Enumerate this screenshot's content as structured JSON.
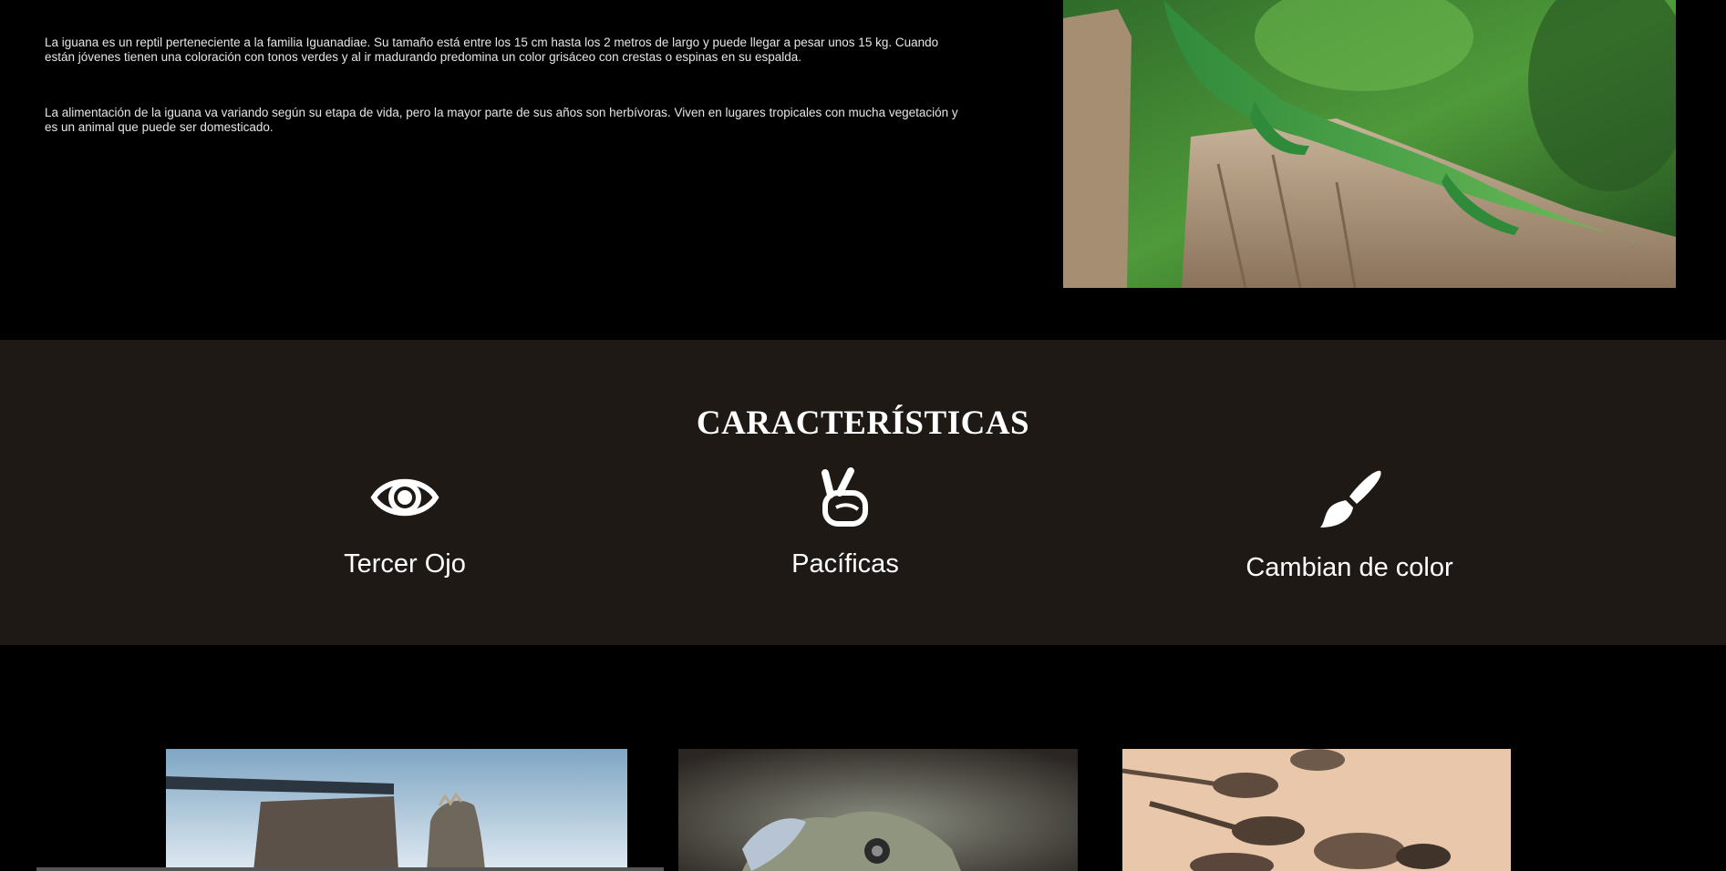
{
  "intro": {
    "paragraph1": "La iguana es un reptil perteneciente a la familia Iguanadiae. Su tamaño está entre los 15 cm hasta los 2 metros de largo y puede llegar a pesar unos 15 kg. Cuando están jóvenes tienen una coloración con tonos verdes y al ir madurando predomina un color grisáceo con crestas o espinas en su espalda.",
    "paragraph2": "La alimentación de la iguana va variando según su etapa de vida, pero la mayor parte de sus años son herbívoras. Viven en lugares tropicales con mucha vegetación y es un animal que puede ser domesticado."
  },
  "features": {
    "title": "CARACTERÍSTICAS",
    "items": [
      {
        "label": "Tercer Ojo",
        "icon": "eye-icon"
      },
      {
        "label": "Pacíficas",
        "icon": "peace-hand-icon"
      },
      {
        "label": "Cambian de color",
        "icon": "paintbrush-icon"
      }
    ]
  },
  "colors": {
    "page_background": "#000000",
    "features_background": "#1e1915",
    "text": "#ffffff"
  }
}
